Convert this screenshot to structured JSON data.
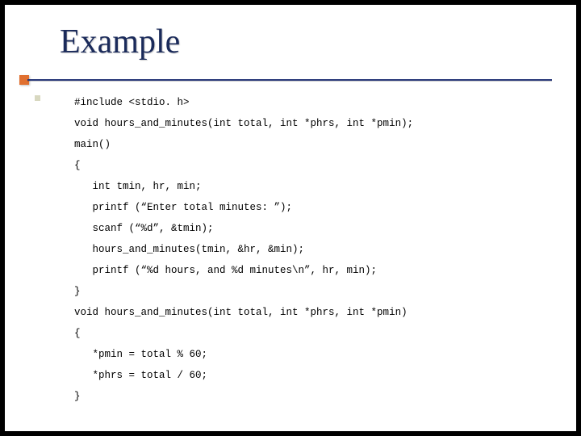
{
  "title": "Example",
  "code_lines": [
    "#include <stdio. h>",
    "void hours_and_minutes(int total, int *phrs, int *pmin);",
    "main()",
    "{",
    "   int tmin, hr, min;",
    "   printf (“Enter total minutes: ”);",
    "   scanf (“%d”, &tmin);",
    "   hours_and_minutes(tmin, &hr, &min);",
    "   printf (“%d hours, and %d minutes\\n”, hr, min);",
    "}",
    "void hours_and_minutes(int total, int *phrs, int *pmin)",
    "{",
    "   *pmin = total % 60;",
    "   *phrs = total / 60;",
    "}"
  ]
}
